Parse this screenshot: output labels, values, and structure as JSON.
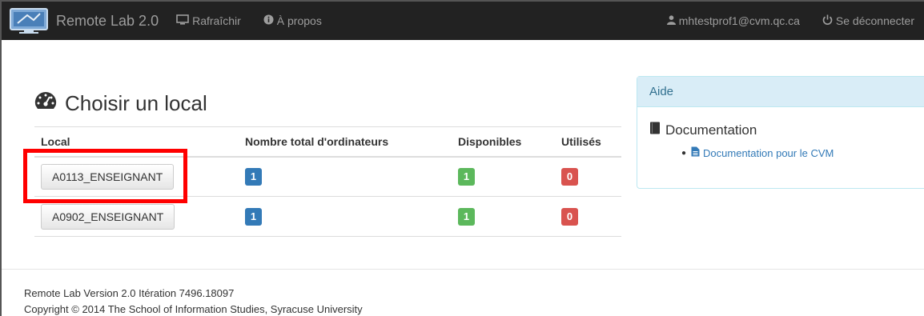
{
  "navbar": {
    "brand": "Remote Lab 2.0",
    "refresh_label": "Rafraîchir",
    "about_label": "À propos",
    "user_label": "mhtestprof1@cvm.qc.ca",
    "logout_label": "Se déconnecter",
    "icons": {
      "logo": "remote-lab-logo",
      "refresh": "monitor-icon",
      "about": "info-circle-icon",
      "user": "user-icon",
      "logout": "power-icon"
    }
  },
  "main": {
    "title": "Choisir un local",
    "title_icon": "dashboard-icon",
    "table": {
      "headers": [
        "Local",
        "Nombre total d'ordinateurs",
        "Disponibles",
        "Utilisés"
      ],
      "rows": [
        {
          "local": "A0113_ENSEIGNANT",
          "total": "1",
          "available": "1",
          "used": "0"
        },
        {
          "local": "A0902_ENSEIGNANT",
          "total": "1",
          "available": "1",
          "used": "0"
        }
      ]
    }
  },
  "help": {
    "heading": "Aide",
    "section_title": "Documentation",
    "section_icon": "book-icon",
    "links": [
      "Documentation pour le CVM"
    ],
    "link_icon": "file-text-icon"
  },
  "footer": {
    "version": "Remote Lab Version 2.0 Itération 7496.18097",
    "copyright": "Copyright © 2014 The School of Information Studies, Syracuse University"
  },
  "colors": {
    "navbar_bg": "#222222",
    "badge_total": "#337ab7",
    "badge_available": "#5cb85c",
    "badge_used": "#d9534f",
    "highlight": "#ff0000"
  }
}
